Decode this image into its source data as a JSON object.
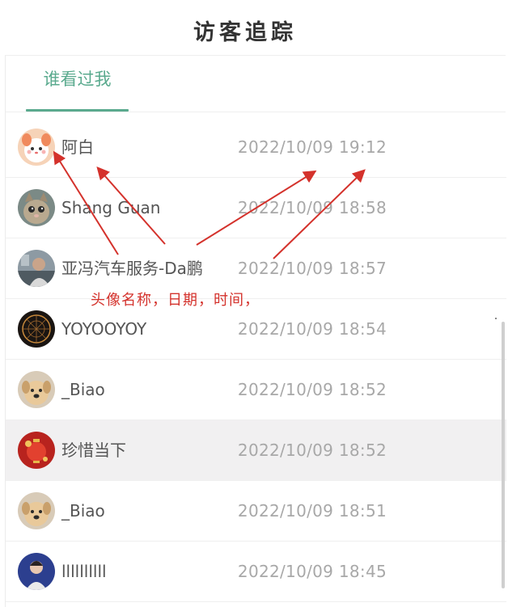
{
  "header": {
    "title": "访客追踪"
  },
  "tabs": [
    {
      "label": "谁看过我",
      "active": true
    }
  ],
  "accent_color": "#5aaa8e",
  "visitors": [
    {
      "name": "阿白",
      "time": "2022/10/09 19:12",
      "avatar": "white-cat-cartoon-avatar"
    },
    {
      "name": "Shang Guan",
      "time": "2022/10/09 18:58",
      "avatar": "cat-photo-avatar"
    },
    {
      "name": "亚冯汽车服务-Da鹏",
      "time": "2022/10/09 18:57",
      "avatar": "person-photo-avatar"
    },
    {
      "name": "YOYOOYOY",
      "time": "2022/10/09 18:54",
      "avatar": "ferris-wheel-night-avatar"
    },
    {
      "name": "_Biao",
      "time": "2022/10/09 18:52",
      "avatar": "dog-photo-avatar"
    },
    {
      "name": "珍惜当下",
      "time": "2022/10/09 18:52",
      "avatar": "red-lantern-avatar"
    },
    {
      "name": "_Biao",
      "time": "2022/10/09 18:51",
      "avatar": "dog-photo-avatar"
    },
    {
      "name": "llllllllll",
      "time": "2022/10/09 18:45",
      "avatar": "person-blue-photo-avatar"
    }
  ],
  "annotation": {
    "text": "头像名称，日期，时间，",
    "color": "#d4322c"
  }
}
